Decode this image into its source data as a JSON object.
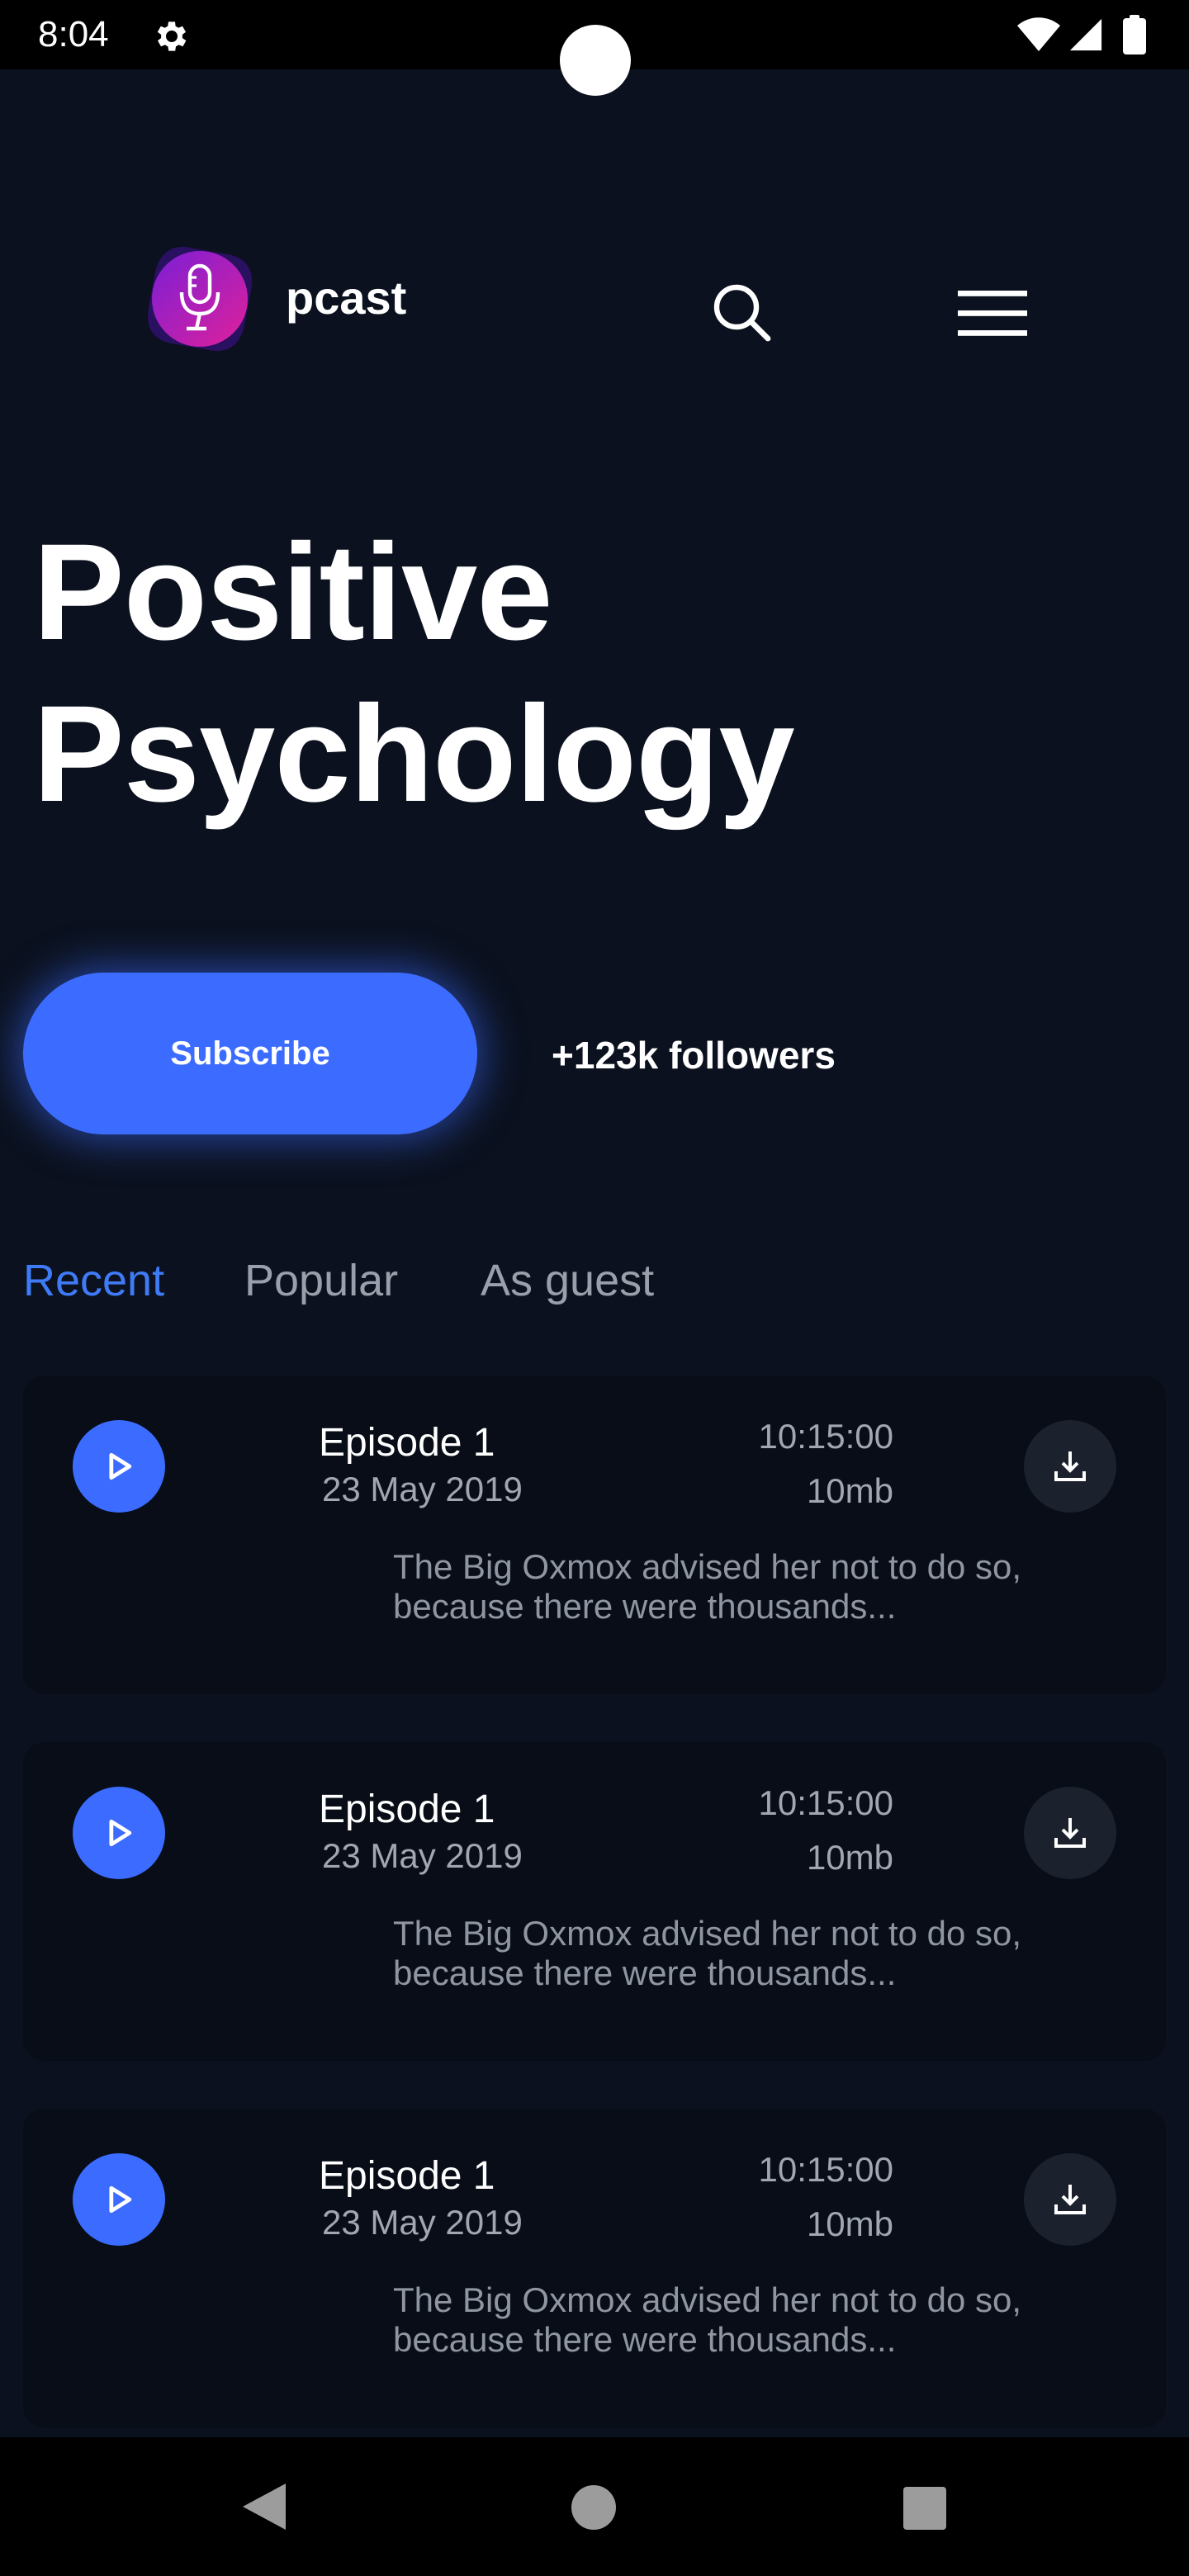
{
  "status_bar": {
    "time": "8:04",
    "icons": [
      "gear-icon",
      "wifi-icon",
      "signal-icon",
      "battery-icon"
    ]
  },
  "header": {
    "app_name": "pcast",
    "logo_icon": "microphone-icon",
    "search_icon": "search-icon",
    "menu_icon": "hamburger-menu-icon"
  },
  "podcast": {
    "title_line1": "Positive",
    "title_line2": "Psychology",
    "subscribe_label": "Subscribe",
    "followers": "+123k followers"
  },
  "tabs": [
    {
      "label": "Recent",
      "active": true
    },
    {
      "label": "Popular",
      "active": false
    },
    {
      "label": "As guest",
      "active": false
    }
  ],
  "episodes": [
    {
      "title": "Episode 1",
      "date": "23 May 2019",
      "duration": "10:15:00",
      "size": "10mb",
      "description": "The Big Oxmox advised her not to do so, because there were thousands..."
    },
    {
      "title": "Episode 1",
      "date": "23 May 2019",
      "duration": "10:15:00",
      "size": "10mb",
      "description": "The Big Oxmox advised her not to do so, because there were thousands..."
    },
    {
      "title": "Episode 1",
      "date": "23 May 2019",
      "duration": "10:15:00",
      "size": "10mb",
      "description": "The Big Oxmox advised her not to do so, because there were thousands..."
    }
  ],
  "colors": {
    "background": "#0b111e",
    "card": "#080d17",
    "accent": "#3c6cff",
    "active_tab": "#3f7bf7",
    "muted_text": "#9aa0ab"
  }
}
